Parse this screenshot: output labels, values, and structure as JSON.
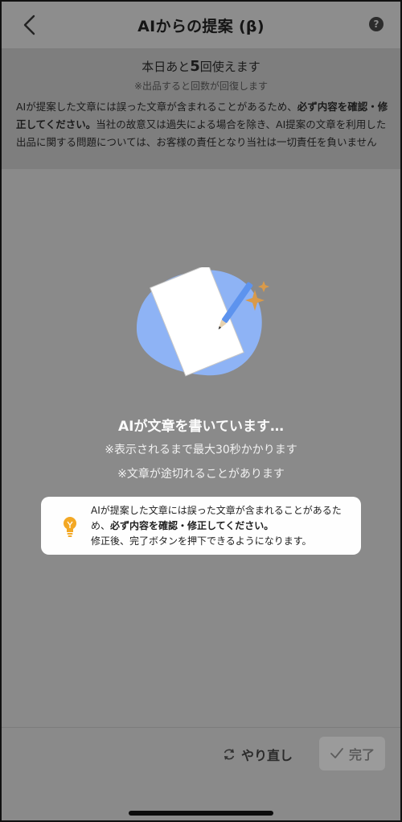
{
  "header": {
    "title": "AIからの提案 (β)",
    "help_label": "?"
  },
  "notice": {
    "remaining_prefix": "本日あと",
    "remaining_count": "5",
    "remaining_suffix": "回使えます",
    "recover_note": "※出品すると回数が回復します",
    "disclaimer_part1": "AIが提案した文章には誤った文章が含まれることがあるため、",
    "disclaimer_bold": "必ず内容を確認・修正してください。",
    "disclaimer_part2": "当社の故意又は過失による場合を除き、AI提案の文章を利用した出品に関する問題については、お客様の責任となり当社は一切責任を負いません"
  },
  "status": {
    "title": "AIが文章を書いています…",
    "note_time": "※表示されるまで最大30秒かかります",
    "note_cut": "※文章が途切れることがあります"
  },
  "card": {
    "text_part1": "AIが提案した文章には誤った文章が含まれることがあるため、",
    "text_bold": "必ず内容を確認・修正してください。",
    "text_part2": "修正後、完了ボタンを押下できるようになります。"
  },
  "footer": {
    "redo_label": "やり直し",
    "done_label": "完了"
  },
  "icons": {
    "back": "chevron-left-icon",
    "help": "help-icon",
    "bulb": "lightbulb-icon",
    "redo": "refresh-icon",
    "done": "check-icon"
  },
  "colors": {
    "blob": "#8eb3f5",
    "sparkle": "#d99a4a",
    "bulb": "#f3a825"
  }
}
